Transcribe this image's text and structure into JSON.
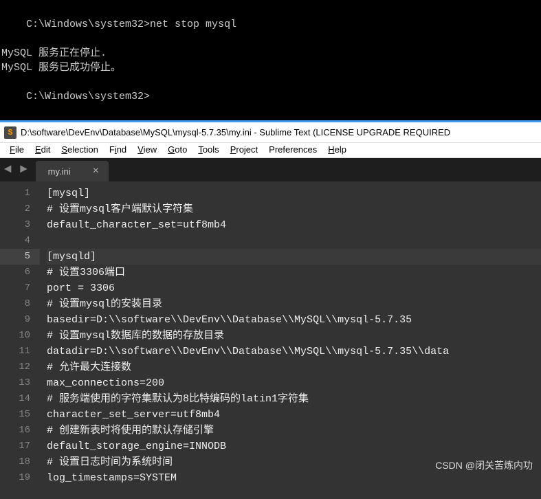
{
  "terminal": {
    "lines": [
      {
        "prompt": "C:\\Windows\\system32>",
        "cmd": "net stop mysql"
      },
      {
        "text": "MySQL 服务正在停止."
      },
      {
        "text": "MySQL 服务已成功停止。"
      },
      {
        "text": ""
      },
      {
        "text": ""
      },
      {
        "prompt": "C:\\Windows\\system32>",
        "cmd": ""
      }
    ]
  },
  "sublime": {
    "title": "D:\\software\\DevEnv\\Database\\MySQL\\mysql-5.7.35\\my.ini - Sublime Text (LICENSE UPGRADE REQUIRED",
    "app_icon_letter": "S",
    "menus": {
      "file": "File",
      "edit": "Edit",
      "selection": "Selection",
      "find": "Find",
      "view": "View",
      "goto": "Goto",
      "tools": "Tools",
      "project": "Project",
      "preferences": "Preferences",
      "help": "Help"
    },
    "tab": {
      "label": "my.ini",
      "close": "×"
    },
    "nav": {
      "left": "◄",
      "right": "►"
    },
    "highlight_line": 5,
    "code_lines": [
      "[mysql]",
      "# 设置mysql客户端默认字符集",
      "default_character_set=utf8mb4",
      "",
      "[mysqld]",
      "# 设置3306端口",
      "port = 3306",
      "# 设置mysql的安装目录",
      "basedir=D:\\\\software\\\\DevEnv\\\\Database\\\\MySQL\\\\mysql-5.7.35",
      "# 设置mysql数据库的数据的存放目录",
      "datadir=D:\\\\software\\\\DevEnv\\\\Database\\\\MySQL\\\\mysql-5.7.35\\\\data",
      "# 允许最大连接数",
      "max_connections=200",
      "# 服务端使用的字符集默认为8比特编码的latin1字符集",
      "character_set_server=utf8mb4",
      "# 创建新表时将使用的默认存储引擎",
      "default_storage_engine=INNODB",
      "# 设置日志时间为系统时间",
      "log_timestamps=SYSTEM"
    ]
  },
  "watermark": "CSDN @闭关苦炼内功"
}
